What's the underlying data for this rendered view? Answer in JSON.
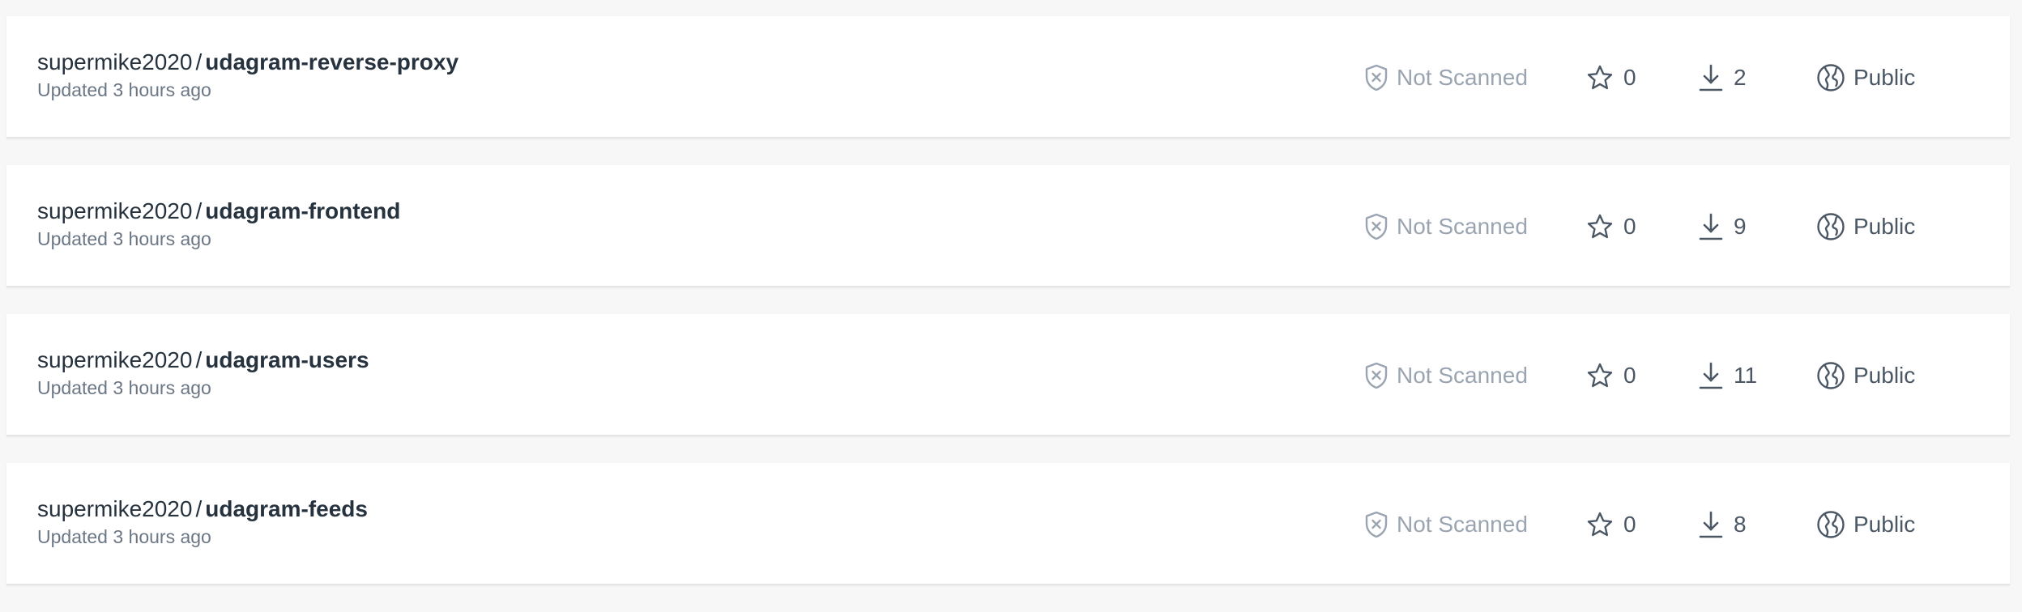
{
  "colors": {
    "background": "#f7f7f7",
    "card": "#ffffff",
    "text_primary": "#27323f",
    "text_secondary": "#6b7785",
    "text_muted": "#9aa5b1",
    "icon": "#4b5765"
  },
  "icons": {
    "scan": "shield-x-icon",
    "stars": "star-icon",
    "pulls": "download-icon",
    "visibility": "globe-icon"
  },
  "repositories": [
    {
      "namespace": "supermike2020",
      "separator": "/",
      "name": "udagram-reverse-proxy",
      "updated": "Updated 3 hours ago",
      "scan_status": "Not Scanned",
      "stars": "0",
      "pulls": "2",
      "visibility": "Public"
    },
    {
      "namespace": "supermike2020",
      "separator": "/",
      "name": "udagram-frontend",
      "updated": "Updated 3 hours ago",
      "scan_status": "Not Scanned",
      "stars": "0",
      "pulls": "9",
      "visibility": "Public"
    },
    {
      "namespace": "supermike2020",
      "separator": "/",
      "name": "udagram-users",
      "updated": "Updated 3 hours ago",
      "scan_status": "Not Scanned",
      "stars": "0",
      "pulls": "11",
      "visibility": "Public"
    },
    {
      "namespace": "supermike2020",
      "separator": "/",
      "name": "udagram-feeds",
      "updated": "Updated 3 hours ago",
      "scan_status": "Not Scanned",
      "stars": "0",
      "pulls": "8",
      "visibility": "Public"
    }
  ]
}
